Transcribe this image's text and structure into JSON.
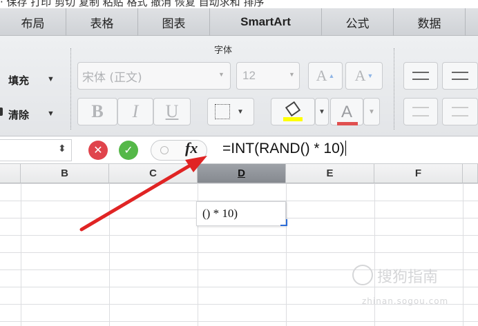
{
  "top_strip": {
    "text": "· 保存  打印  剪切  复制  粘贴  格式  撤消  恢复  自动求和  排序"
  },
  "ribbon_tabs": [
    "布局",
    "表格",
    "图表",
    "SmartArt",
    "公式",
    "数据"
  ],
  "font_group": {
    "title": "字体",
    "fill_label": "填充",
    "clear_label": "清除",
    "font_name": "宋体 (正文)",
    "font_size": "12",
    "bold": "B",
    "italic": "I",
    "underline": "U",
    "grow_font": "A",
    "shrink_font": "A",
    "font_color": "A",
    "fill_color_hex": "#ffff00",
    "font_color_hex": "#e05050"
  },
  "formula_bar": {
    "fx": "fx",
    "formula": "=INT(RAND() * 10)"
  },
  "columns": [
    "B",
    "C",
    "D",
    "E",
    "F"
  ],
  "selected_column": "D",
  "cell_hint": "() * 10)",
  "watermark": {
    "text": "搜狗指南",
    "sub": "zhinan.sogou.com"
  }
}
